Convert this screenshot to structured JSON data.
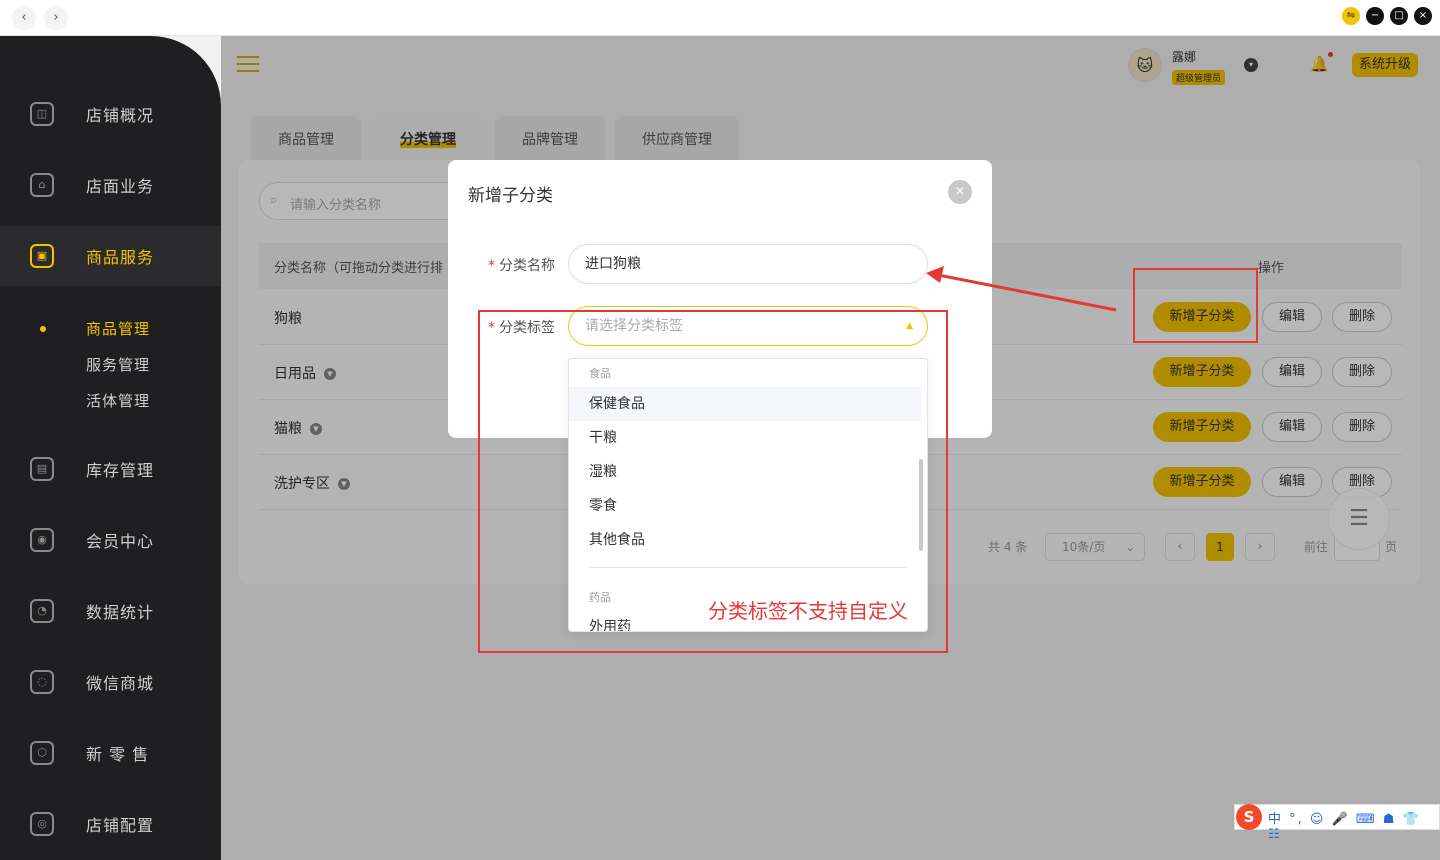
{
  "window": {
    "back": "‹",
    "forward": "›",
    "ext_icon": "⇋",
    "min": "−",
    "max": "□",
    "close": "×"
  },
  "sidebar": {
    "items": [
      {
        "label": "店铺概况",
        "icon": "◫"
      },
      {
        "label": "店面业务",
        "icon": "⌂"
      },
      {
        "label": "商品服务",
        "icon": "▣"
      },
      {
        "label": "库存管理",
        "icon": "▤"
      },
      {
        "label": "会员中心",
        "icon": "◉"
      },
      {
        "label": "数据统计",
        "icon": "◔"
      },
      {
        "label": "微信商城",
        "icon": "◌"
      },
      {
        "label": "新 零 售",
        "icon": "⬡"
      },
      {
        "label": "店铺配置",
        "icon": "◎"
      }
    ],
    "sub_items": [
      "商品管理",
      "服务管理",
      "活体管理"
    ]
  },
  "header": {
    "user_name": "露娜",
    "user_role": "超级管理员",
    "upgrade": "系统升级",
    "avatar": "🐱",
    "bell": "🔔",
    "dd": "▾"
  },
  "tabs": [
    "商品管理",
    "分类管理",
    "品牌管理",
    "供应商管理"
  ],
  "search": {
    "placeholder": "请输入分类名称",
    "icon": "⌕"
  },
  "table": {
    "headers": {
      "name": "分类名称（可拖动分类进行排",
      "op": "操作"
    },
    "rows": [
      {
        "name": "狗粮",
        "expandable": false
      },
      {
        "name": "日用品",
        "expandable": true
      },
      {
        "name": "猫粮",
        "expandable": true
      },
      {
        "name": "洗护专区",
        "expandable": true
      }
    ],
    "actions": {
      "add": "新增子分类",
      "edit": "编辑",
      "delete": "删除"
    }
  },
  "pagination": {
    "total": "共 4 条",
    "page_size": "10条/页",
    "page_size_caret": "⌄",
    "prev": "‹",
    "next": "›",
    "page": "1",
    "goto": "前往",
    "unit": "页",
    "float_icon": "☰"
  },
  "modal": {
    "title": "新增子分类",
    "close": "×",
    "name_label": "分类名称",
    "name_value": "进口狗粮",
    "tag_label": "分类标签",
    "tag_placeholder": "请选择分类标签",
    "caret": "▲",
    "required_mark": "*"
  },
  "dropdown": {
    "groups": [
      {
        "label": "食品",
        "options": [
          "保健食品",
          "干粮",
          "湿粮",
          "零食",
          "其他食品"
        ]
      },
      {
        "label": "药品",
        "options": [
          "外用药"
        ]
      }
    ]
  },
  "annotation": {
    "note": "分类标签不支持自定义",
    "color": "#e53935"
  },
  "ime": {
    "logo": "S",
    "text": "中 °, ☺ 🎤 ⌨ ☗ 👕 ☷"
  },
  "colors": {
    "accent": "#f3c300",
    "sidebar_bg": "#1f1f21",
    "annotation": "#e53935"
  }
}
